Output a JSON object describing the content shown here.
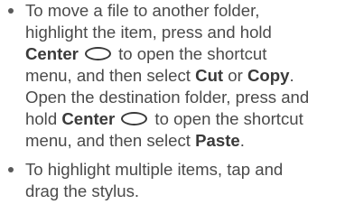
{
  "tips": [
    {
      "lines": [
        [
          {
            "t": "To move a file to another folder,"
          }
        ],
        [
          {
            "t": "highlight the item, press and hold"
          }
        ],
        [
          {
            "t": "Center",
            "b": true
          },
          {
            "icon": "center-button-icon"
          },
          {
            "t": " to open the shortcut"
          }
        ],
        [
          {
            "t": "menu, and then select "
          },
          {
            "t": "Cut",
            "b": true
          },
          {
            "t": " or "
          },
          {
            "t": "Copy",
            "b": true
          },
          {
            "t": "."
          }
        ],
        [
          {
            "t": "Open the destination folder, press and"
          }
        ],
        [
          {
            "t": "hold "
          },
          {
            "t": "Center",
            "b": true
          },
          {
            "icon": "center-button-icon"
          },
          {
            "t": " to open the shortcut"
          }
        ],
        [
          {
            "t": "menu, and then select "
          },
          {
            "t": "Paste",
            "b": true
          },
          {
            "t": "."
          }
        ]
      ]
    },
    {
      "lines": [
        [
          {
            "t": "To highlight multiple items, tap and"
          }
        ],
        [
          {
            "t": "drag the stylus."
          }
        ]
      ]
    }
  ]
}
